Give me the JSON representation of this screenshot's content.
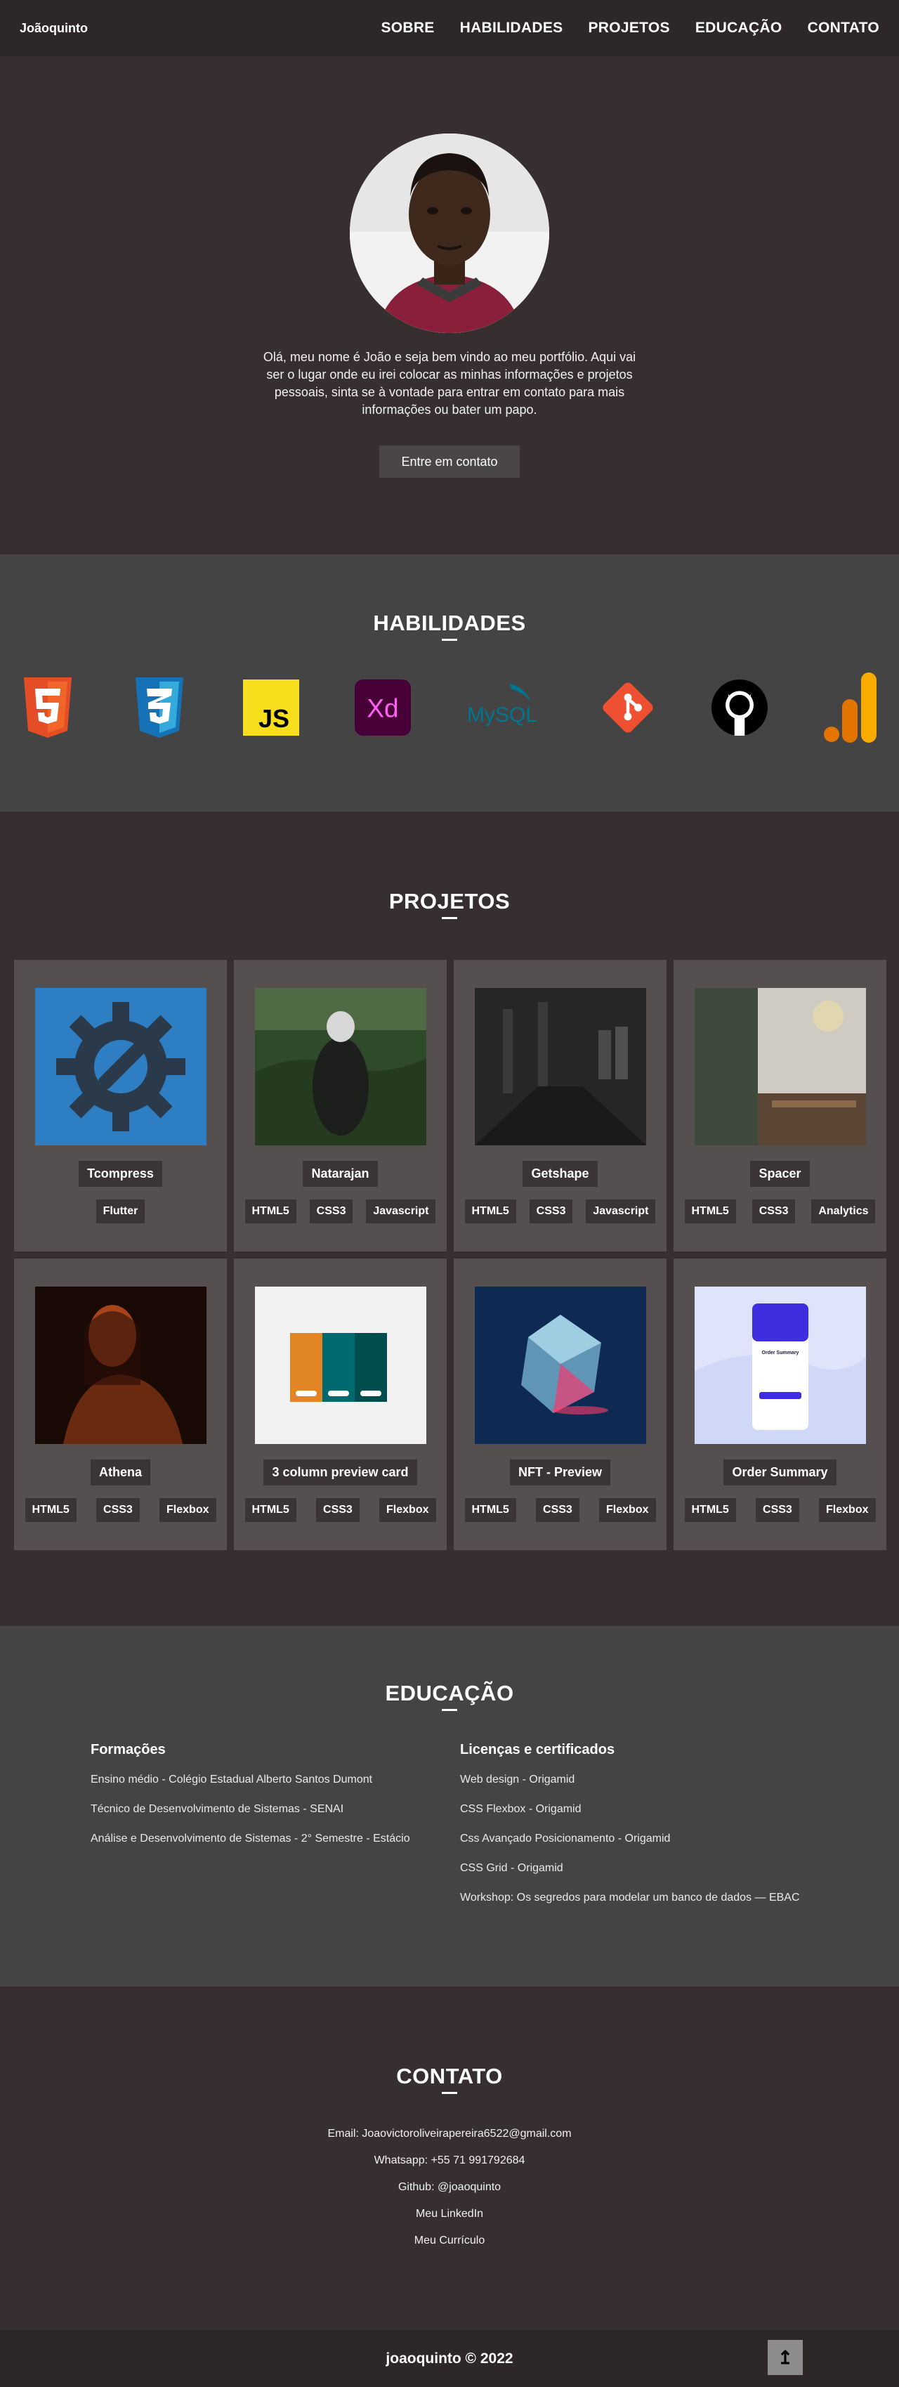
{
  "nav": {
    "brand": "Joãoquinto",
    "links": [
      "SOBRE",
      "HABILIDADES",
      "PROJETOS",
      "EDUCAÇÃO",
      "CONTATO"
    ]
  },
  "hero": {
    "intro": "Olá, meu nome é João e seja bem vindo ao meu portfólio. Aqui vai ser o lugar onde eu irei colocar as minhas informações e projetos pessoais, sinta se à vontade para entrar em contato para mais informações ou bater um papo.",
    "cta": "Entre em contato"
  },
  "skills": {
    "title": "HABILIDADES",
    "items": [
      {
        "name": "HTML5",
        "icon": "html5-icon",
        "color": "#e44d26"
      },
      {
        "name": "CSS3",
        "icon": "css3-icon",
        "color": "#1572b6"
      },
      {
        "name": "JavaScript",
        "icon": "javascript-icon",
        "color": "#f7df1e"
      },
      {
        "name": "Adobe XD",
        "icon": "adobe-xd-icon",
        "color": "#ff61f6"
      },
      {
        "name": "MySQL",
        "icon": "mysql-icon",
        "color": "#00758f"
      },
      {
        "name": "Git",
        "icon": "git-icon",
        "color": "#f05032"
      },
      {
        "name": "GitHub",
        "icon": "github-icon",
        "color": "#000000"
      },
      {
        "name": "Google Analytics",
        "icon": "analytics-icon",
        "color": "#f9ab00"
      }
    ],
    "labels": {
      "js": "JS",
      "xd": "Xd",
      "mysql": "MySQL"
    }
  },
  "projects": {
    "title": "PROJETOS",
    "items": [
      {
        "name": "Tcompress",
        "tags": [
          "Flutter"
        ]
      },
      {
        "name": "Natarajan",
        "tags": [
          "HTML5",
          "CSS3",
          "Javascript"
        ]
      },
      {
        "name": "Getshape",
        "tags": [
          "HTML5",
          "CSS3",
          "Javascript"
        ]
      },
      {
        "name": "Spacer",
        "tags": [
          "HTML5",
          "CSS3",
          "Analytics"
        ]
      },
      {
        "name": "Athena",
        "tags": [
          "HTML5",
          "CSS3",
          "Flexbox"
        ]
      },
      {
        "name": "3 column preview card",
        "tags": [
          "HTML5",
          "CSS3",
          "Flexbox"
        ]
      },
      {
        "name": "NFT - Preview",
        "tags": [
          "HTML5",
          "CSS3",
          "Flexbox"
        ]
      },
      {
        "name": "Order Summary",
        "tags": [
          "HTML5",
          "CSS3",
          "Flexbox"
        ]
      }
    ],
    "mini_card_text": "Order Summary"
  },
  "education": {
    "title": "EDUCAÇÃO",
    "formacoes": {
      "heading": "Formações",
      "items": [
        "Ensino médio - Colégio Estadual Alberto Santos Dumont",
        "Técnico de Desenvolvimento de Sistemas - SENAI",
        "Análise e Desenvolvimento de Sistemas - 2° Semestre - Estácio"
      ]
    },
    "licencas": {
      "heading": "Licenças e certificados",
      "items": [
        "Web design - Origamid",
        "CSS Flexbox - Origamid",
        "Css Avançado Posicionamento - Origamid",
        "CSS Grid - Origamid",
        "Workshop: Os segredos para modelar um banco de dados — EBAC"
      ]
    }
  },
  "contact": {
    "title": "CONTATO",
    "lines": [
      "Email: Joaovictoroliveirapereira6522@gmail.com",
      "Whatsapp: +55 71 991792684",
      "Github: @joaoquinto",
      "Meu LinkedIn",
      "Meu Currículo"
    ]
  },
  "footer": {
    "text": "joaoquinto © 2022",
    "top_button": "↥"
  }
}
